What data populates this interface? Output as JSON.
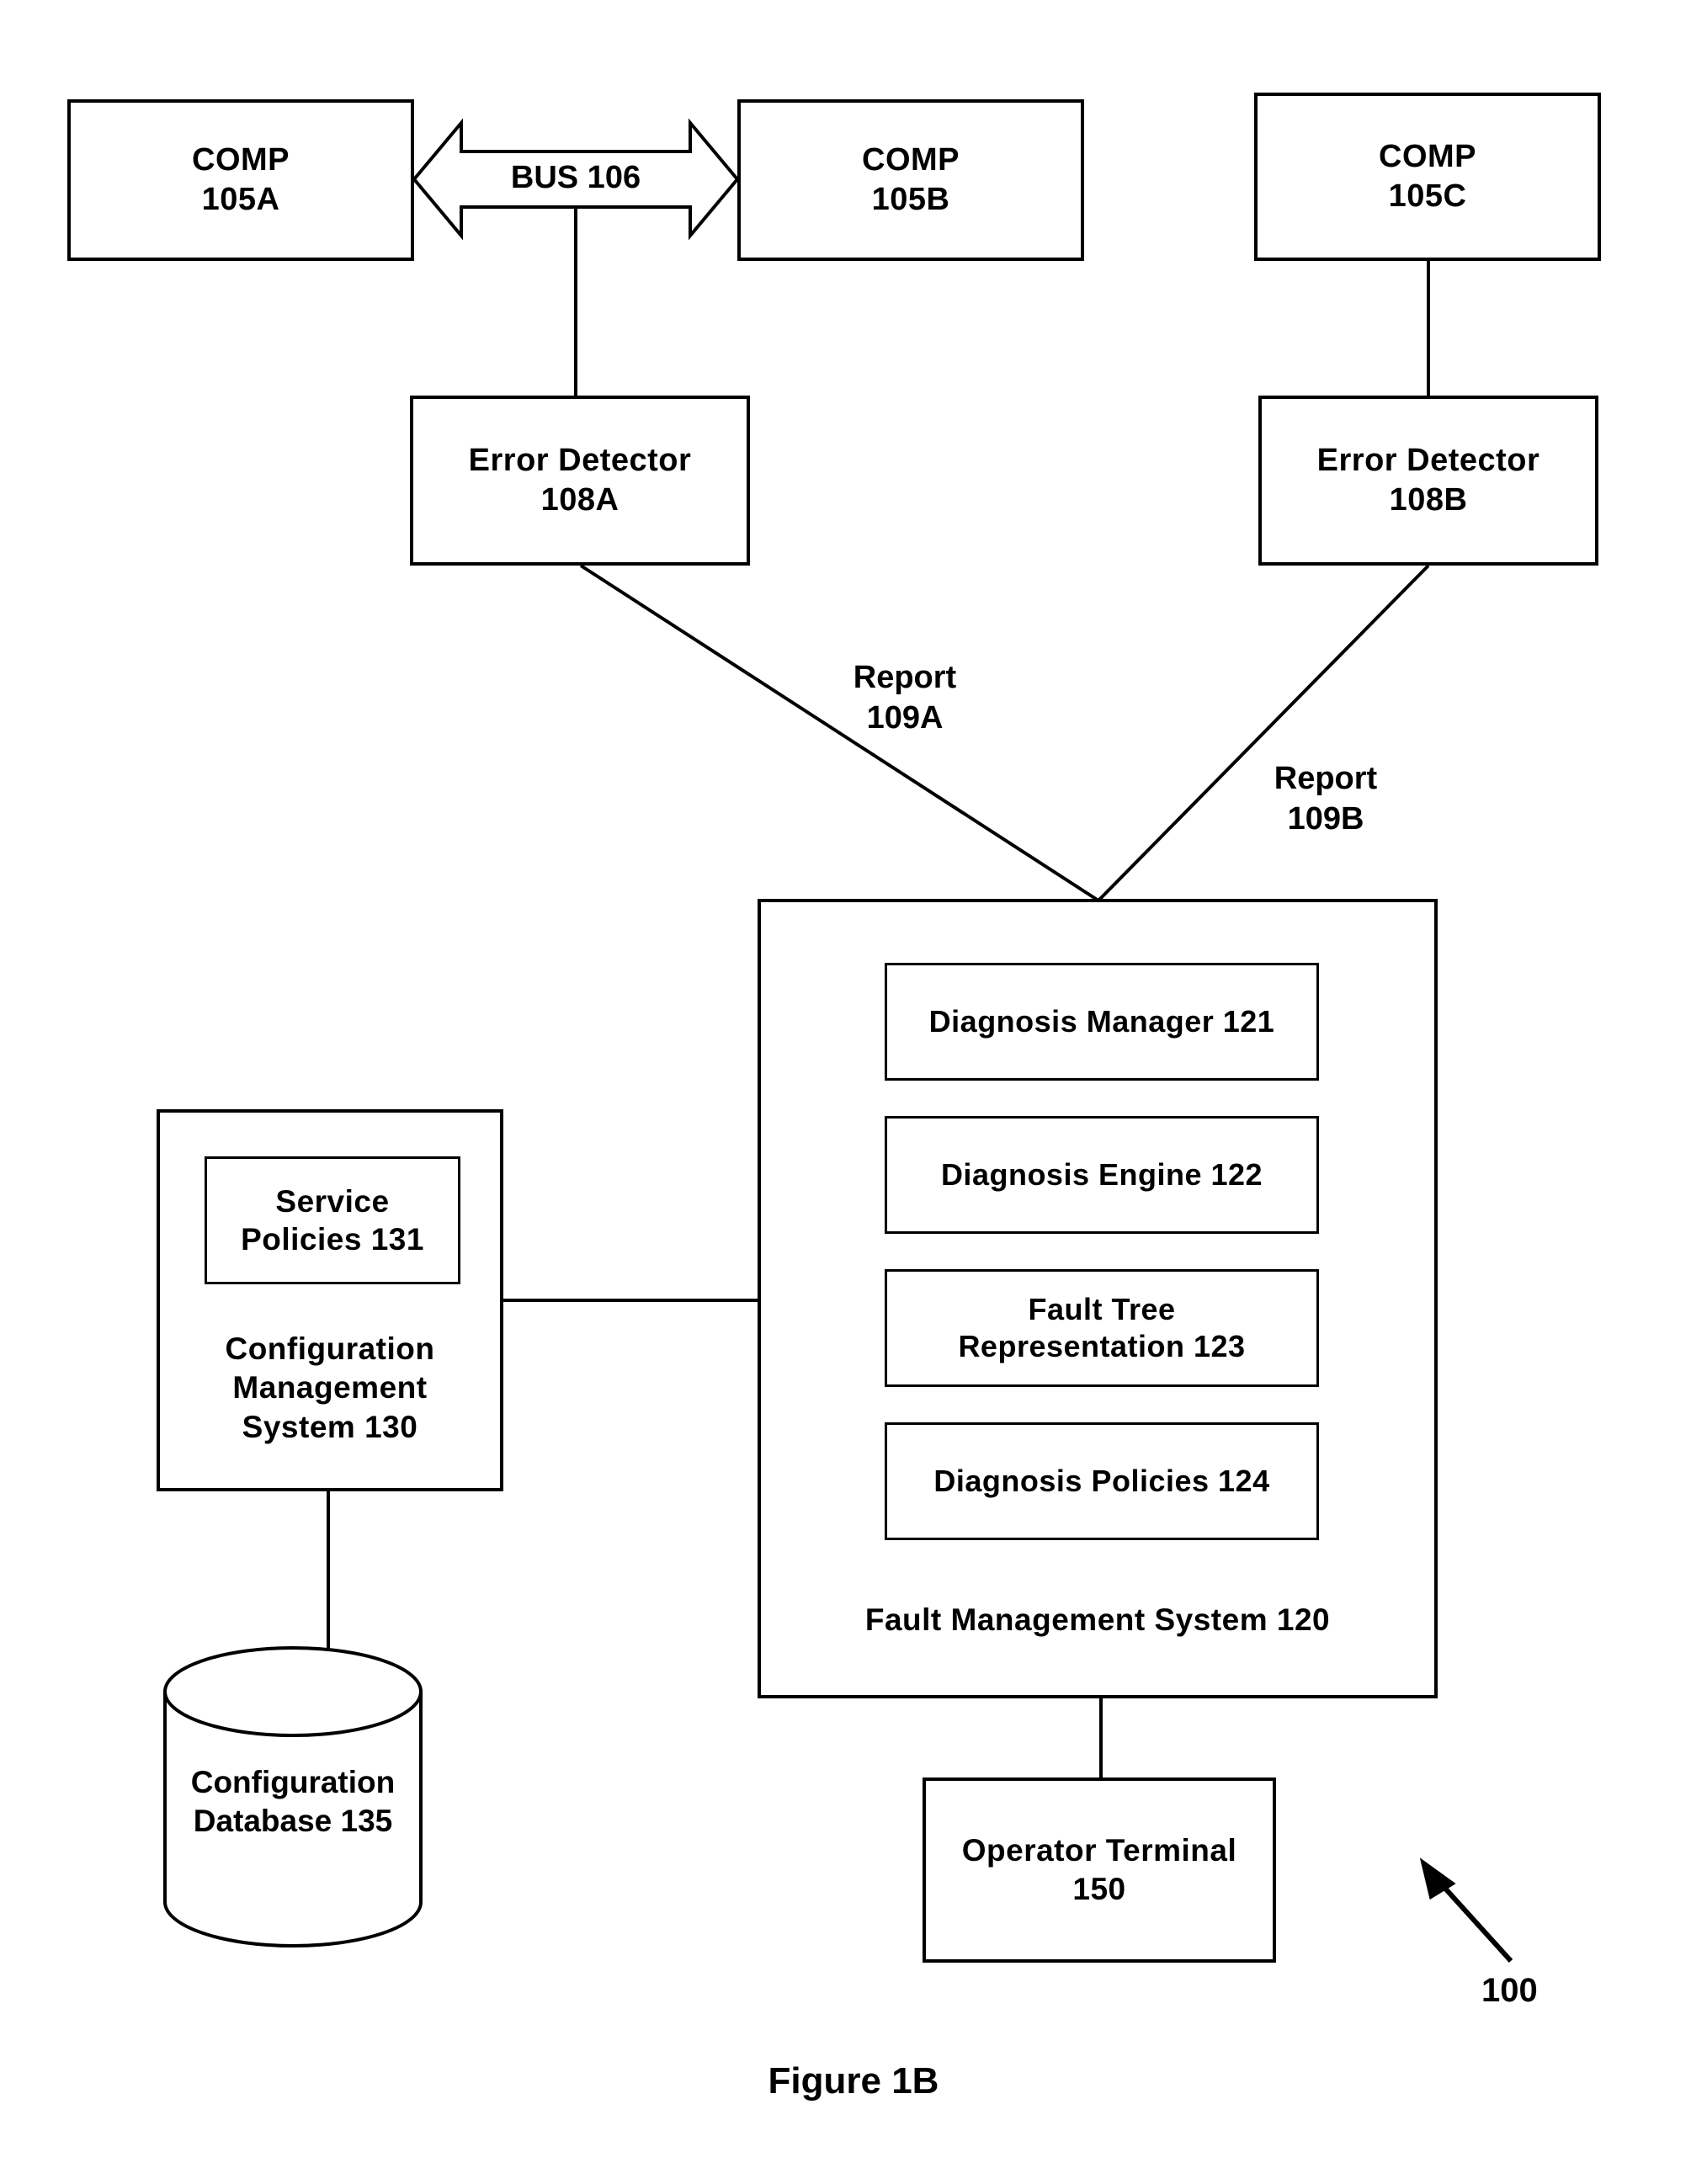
{
  "figure": {
    "caption": "Figure 1B",
    "system_reference": "100"
  },
  "components": {
    "comp_a": "COMP\n105A",
    "comp_b": "COMP\n105B",
    "comp_c": "COMP\n105C",
    "bus": "BUS 106",
    "error_detector_a": "Error Detector\n108A",
    "error_detector_b": "Error Detector\n108B"
  },
  "flows": {
    "report_a": "Report\n109A",
    "report_b": "Report\n109B"
  },
  "fault_management_system": {
    "title": "Fault Management System 120",
    "modules": [
      "Diagnosis Manager 121",
      "Diagnosis Engine 122",
      "Fault Tree\nRepresentation 123",
      "Diagnosis Policies 124"
    ]
  },
  "configuration_management_system": {
    "title": "Configuration\nManagement\nSystem 130",
    "service_policies": "Service\nPolicies 131"
  },
  "configuration_database": "Configuration\nDatabase 135",
  "operator_terminal": "Operator Terminal\n150",
  "colors": {
    "stroke": "#000000",
    "fill": "#ffffff"
  }
}
